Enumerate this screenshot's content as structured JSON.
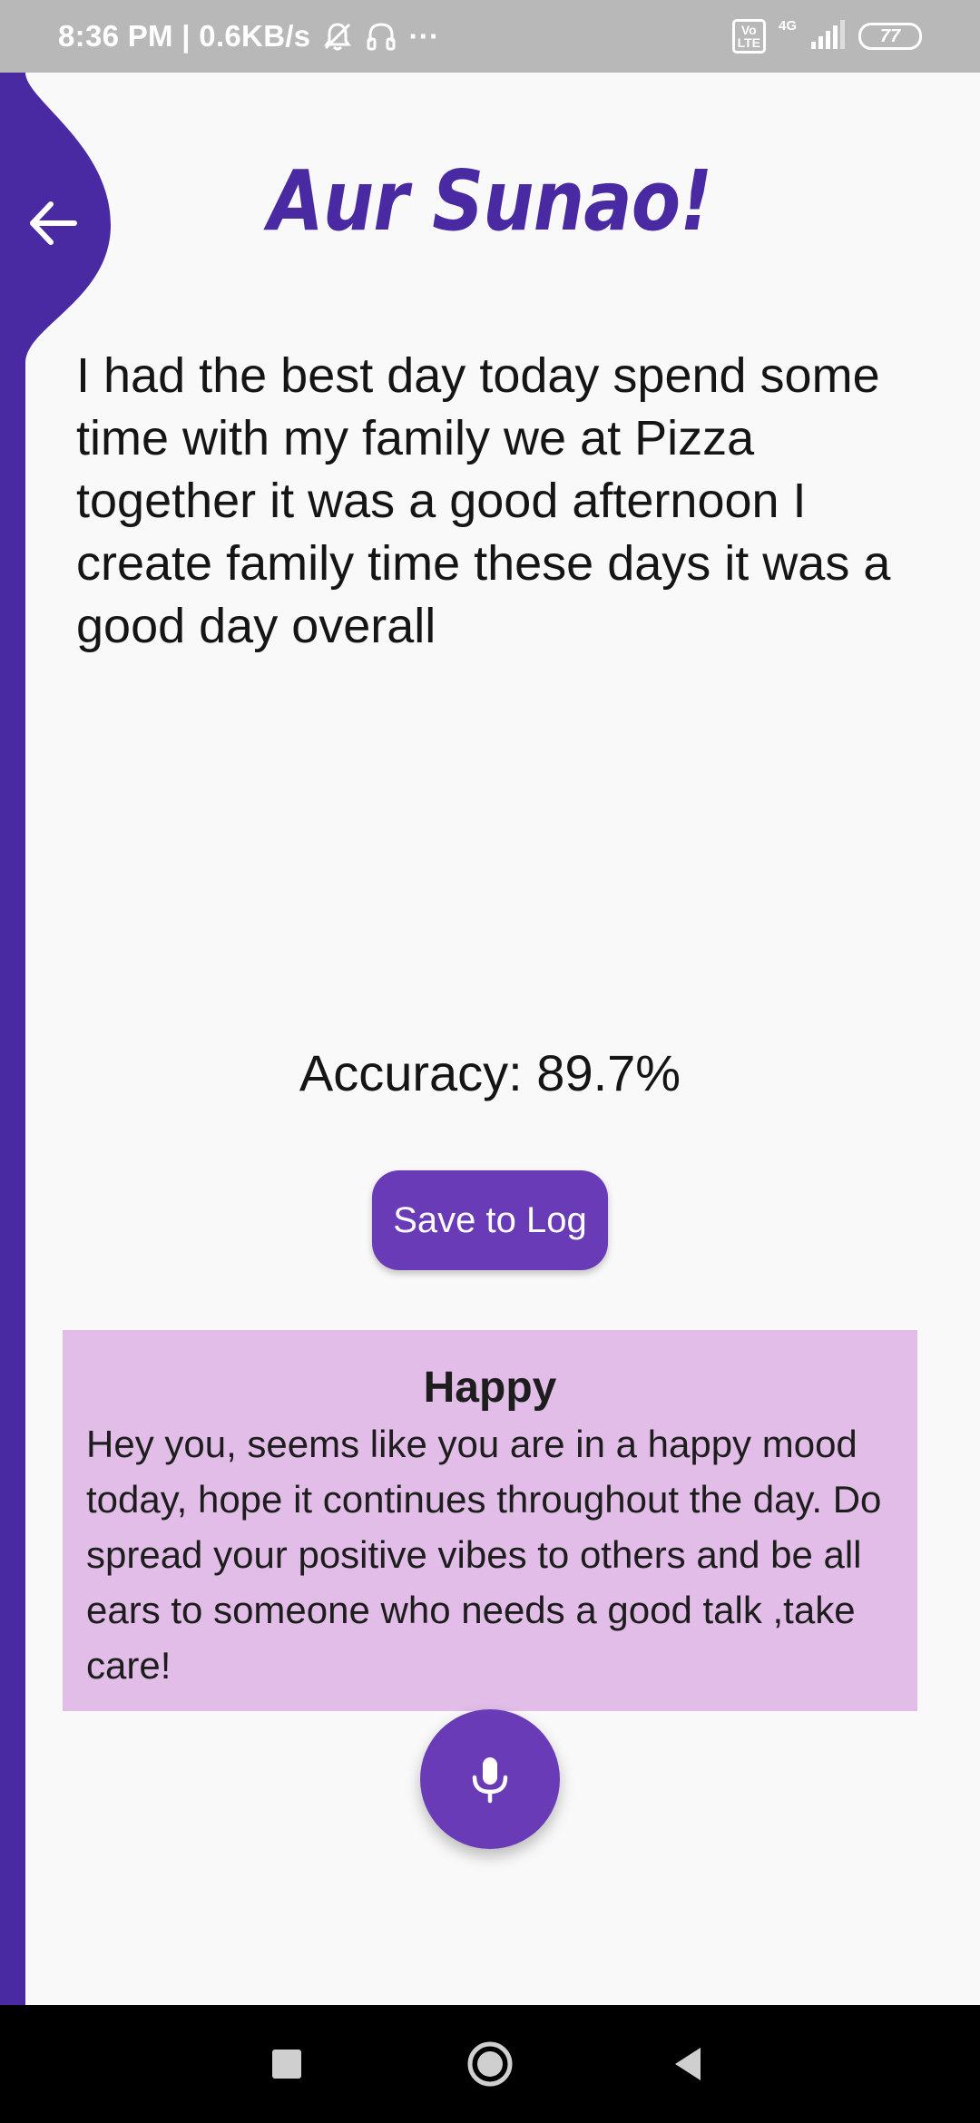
{
  "status_bar": {
    "time_speed": "8:36 PM | 0.6KB/s",
    "more_dots": "···",
    "volte": "Vo\nLTE",
    "network_type": "4G",
    "battery": "77"
  },
  "header": {
    "title": "Aur Sunao!"
  },
  "transcript": {
    "text": "I had the best day today spend some time with my family we at Pizza together it was a good afternoon I create family time these days it was a good day overall"
  },
  "result": {
    "accuracy": "Accuracy: 89.7%",
    "save_label": "Save to Log"
  },
  "mood": {
    "title": "Happy",
    "message": "Hey you, seems like you are in a happy mood today, hope it continues throughout the day. Do spread your positive vibes to others and be all ears to someone who needs a good talk ,take care!"
  },
  "colors": {
    "primary": "#4a2aa2",
    "button": "#6a3bb7",
    "card": "#e1bde8",
    "status_bar": "#b8b8b8"
  },
  "icons": {
    "back": "arrow-left-icon",
    "mic": "microphone-icon",
    "mute": "bell-off-icon",
    "headset": "headset-icon",
    "signal": "signal-icon",
    "battery": "battery-icon",
    "nav_recent": "square-icon",
    "nav_home": "circle-icon",
    "nav_back": "triangle-back-icon"
  }
}
